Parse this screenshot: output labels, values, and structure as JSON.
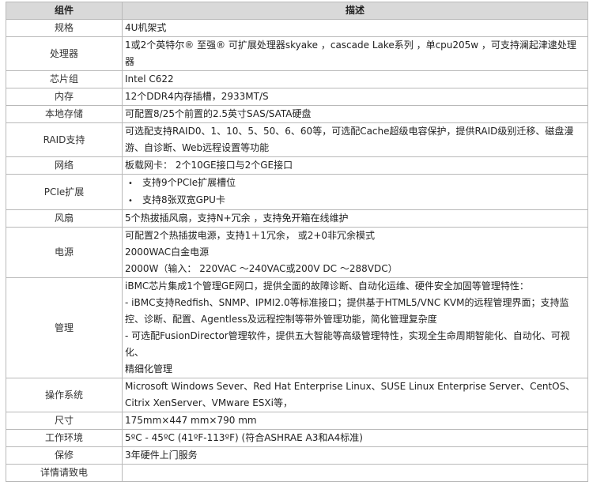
{
  "header": {
    "col1": "组件",
    "col2": "描述"
  },
  "rows": [
    {
      "label": "规格",
      "lines": [
        "4U机架式"
      ]
    },
    {
      "label": "处理器",
      "lines": [
        "1或2个英特尔® 至强® 可扩展处理器skyake ，cascade  Lake系列 ，单cpu205w ，可支持澜起津逮处理器"
      ]
    },
    {
      "label": "芯片组",
      "lines": [
        "Intel C622"
      ]
    },
    {
      "label": "内存",
      "lines": [
        "12个DDR4内存插槽，2933MT/S"
      ]
    },
    {
      "label": "本地存储",
      "lines": [
        "可配置8/25个前置的2.5英寸SAS/SATA硬盘"
      ]
    },
    {
      "label": "RAID支持",
      "lines": [
        "可选配支持RAID0、1、10、5、50、6、60等，可选配Cache超级电容保护，提供RAID级别迁移、磁盘漫游、自诊断、Web远程设置等功能"
      ]
    },
    {
      "label": "网络",
      "lines": [
        "板载网卡：  2个10GE接口与2个GE接口"
      ]
    },
    {
      "label": "PCIe扩展",
      "bullets": [
        "支持9个PCIe扩展槽位",
        "支持8张双宽GPU卡"
      ]
    },
    {
      "label": "风扇",
      "lines": [
        "5个热拔插风扇，支持N+冗余 ，支持免开箱在线维护"
      ]
    },
    {
      "label": "电源",
      "lines": [
        "可配置2个热插拔电源，支持1＋1冗余，  或2+0非冗余模式",
        "2000WAC白金电源",
        "2000W（输入： 220VAC ～240VAC或200V DC ～288VDC）"
      ]
    },
    {
      "label": "管理",
      "lines": [
        "iBMC芯片集成1个管理GE网口，提供全面的故障诊断、自动化运维、硬件安全加固等管理特性：",
        "- iBMC支持Redfish、SNMP、IPMI2.0等标准接口；提供基于HTML5/VNC KVM的远程管理界面；支持监控、诊断、配置、Agentless及远程控制等带外管理功能，简化管理复杂度",
        "- 可选配FusionDirector管理软件，提供五大智能等高级管理特性，实现全生命周期智能化、自动化、可视化、",
        "精细化管理"
      ]
    },
    {
      "label": "操作系统",
      "lines": [
        "Microsoft Windows Sever、Red Hat Enterprise Linux、SUSE Linux Enterprise Server、CentOS、Citrix XenServer、VMware ESXi等，"
      ]
    },
    {
      "label": "尺寸",
      "lines": [
        "175mm×447 mm×790 mm"
      ]
    },
    {
      "label": "工作环境",
      "lines": [
        "5ºC - 45ºC (41ºF-113ºF) (符合ASHRAE A3和A4标准)"
      ]
    },
    {
      "label": "保修",
      "lines": [
        "3年硬件上门服务"
      ]
    },
    {
      "label": "详情请致电",
      "lines": [
        ""
      ]
    }
  ]
}
